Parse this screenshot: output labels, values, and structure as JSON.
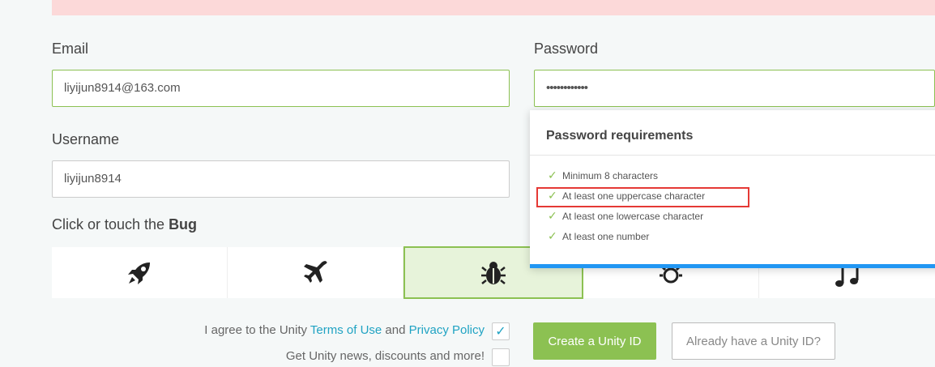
{
  "form": {
    "email_label": "Email",
    "email_value": "liyijun8914@163.com",
    "password_label": "Password",
    "password_value": "••••••••••••",
    "username_label": "Username",
    "username_value": "liyijun8914"
  },
  "captcha": {
    "prompt_prefix": "Click or touch the ",
    "prompt_target": "Bug",
    "icons": [
      "rocket-icon",
      "airplane-icon",
      "bug-icon",
      "sun-icon",
      "music-note-icon"
    ],
    "selected": "bug-icon"
  },
  "password_requirements": {
    "title": "Password requirements",
    "items": [
      "Minimum 8 characters",
      "At least one uppercase character",
      "At least one lowercase character",
      "At least one number"
    ]
  },
  "agreement": {
    "prefix": "I agree to the Unity ",
    "terms_link": "Terms of Use",
    "and": " and ",
    "privacy_link": "Privacy Policy",
    "news_label": "Get Unity news, discounts and more!"
  },
  "buttons": {
    "create": "Create a Unity ID",
    "have_id": "Already have a Unity ID?"
  },
  "colors": {
    "accent_green": "#8cc152",
    "link_blue": "#20a3c3",
    "error_bg": "#fcd9d9",
    "highlight_red": "#e53935",
    "popover_border": "#2196f3"
  }
}
